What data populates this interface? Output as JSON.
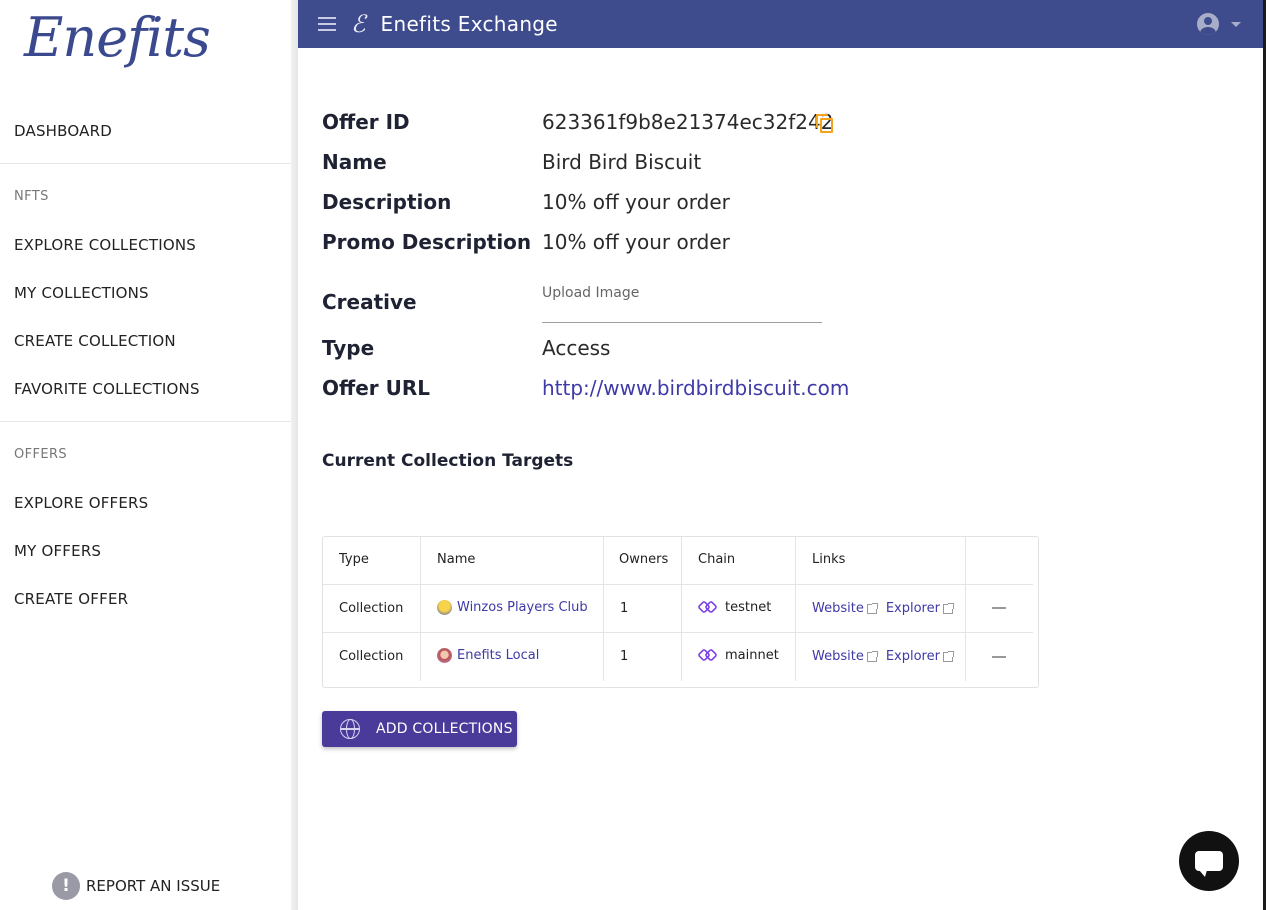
{
  "sidebar": {
    "logo": "Enefits",
    "dashboard": "DASHBOARD",
    "nfts_section": "NFTS",
    "nft_items": [
      "EXPLORE COLLECTIONS",
      "MY COLLECTIONS",
      "CREATE COLLECTION",
      "FAVORITE COLLECTIONS"
    ],
    "offers_section": "OFFERS",
    "offer_items": [
      "EXPLORE OFFERS",
      "MY OFFERS",
      "CREATE OFFER"
    ],
    "report_issue": "REPORT AN ISSUE"
  },
  "header": {
    "brand_glyph": "ℰ",
    "title": "Enefits Exchange"
  },
  "offer": {
    "id_label": "Offer ID",
    "id": "623361f9b8e21374ec32f242",
    "name_label": "Name",
    "name": "Bird Bird Biscuit",
    "description_label": "Description",
    "description": "10% off your order",
    "promo_label": "Promo Description",
    "promo": "10% off your order",
    "creative_label": "Creative",
    "creative_placeholder": "Upload Image",
    "type_label": "Type",
    "type": "Access",
    "url_label": "Offer URL",
    "url": "http://www.birdbirdbiscuit.com"
  },
  "targets": {
    "title": "Current Collection Targets",
    "columns": [
      "Type",
      "Name",
      "Owners",
      "Chain",
      "Links"
    ],
    "rows": [
      {
        "type": "Collection",
        "name": "Winzos Players Club",
        "owners": "1",
        "chain": "testnet",
        "website": "Website",
        "explorer": "Explorer"
      },
      {
        "type": "Collection",
        "name": "Enefits Local",
        "owners": "1",
        "chain": "mainnet",
        "website": "Website",
        "explorer": "Explorer"
      }
    ],
    "add_button": "ADD COLLECTIONS"
  },
  "colors": {
    "header": "#3e4c8e",
    "accent": "#4a3b9a",
    "link": "#3e3aa6",
    "copy_icon": "#f2a51a",
    "chain_icon": "#7b3fe4"
  },
  "icons": [
    "menu-icon",
    "brand-icon",
    "account-icon",
    "caret-down-icon",
    "copy-icon",
    "polygon-chain-icon",
    "external-link-icon",
    "remove-icon",
    "globe-icon",
    "chat-icon",
    "alert-icon"
  ]
}
